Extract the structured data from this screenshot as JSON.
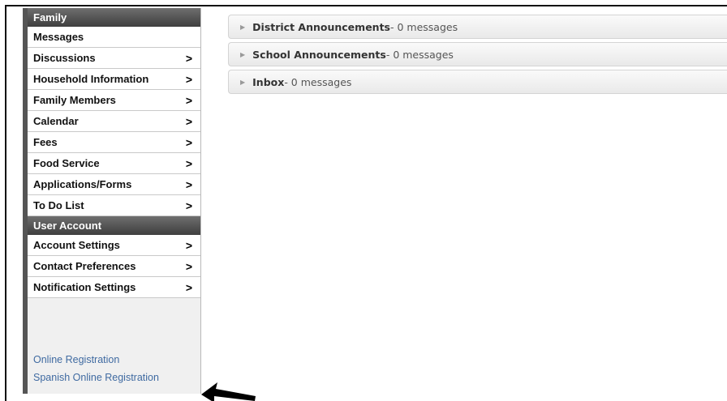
{
  "sidebar": {
    "family_header": "Family",
    "family_items": [
      {
        "label": "Messages",
        "chevron": ""
      },
      {
        "label": "Discussions",
        "chevron": ">"
      },
      {
        "label": "Household Information",
        "chevron": ">"
      },
      {
        "label": "Family Members",
        "chevron": ">"
      },
      {
        "label": "Calendar",
        "chevron": ">"
      },
      {
        "label": "Fees",
        "chevron": ">"
      },
      {
        "label": "Food Service",
        "chevron": ">"
      },
      {
        "label": "Applications/Forms",
        "chevron": ">"
      },
      {
        "label": "To Do List",
        "chevron": ">"
      }
    ],
    "account_header": "User Account",
    "account_items": [
      {
        "label": "Account Settings",
        "chevron": ">"
      },
      {
        "label": "Contact Preferences",
        "chevron": ">"
      },
      {
        "label": "Notification Settings",
        "chevron": ">"
      }
    ],
    "links": [
      "Online Registration",
      "Spanish Online Registration"
    ]
  },
  "panels": [
    {
      "title": "District Announcements",
      "count": " - 0 messages"
    },
    {
      "title": "School Announcements",
      "count": " - 0 messages"
    },
    {
      "title": "Inbox",
      "count": " - 0 messages"
    }
  ]
}
